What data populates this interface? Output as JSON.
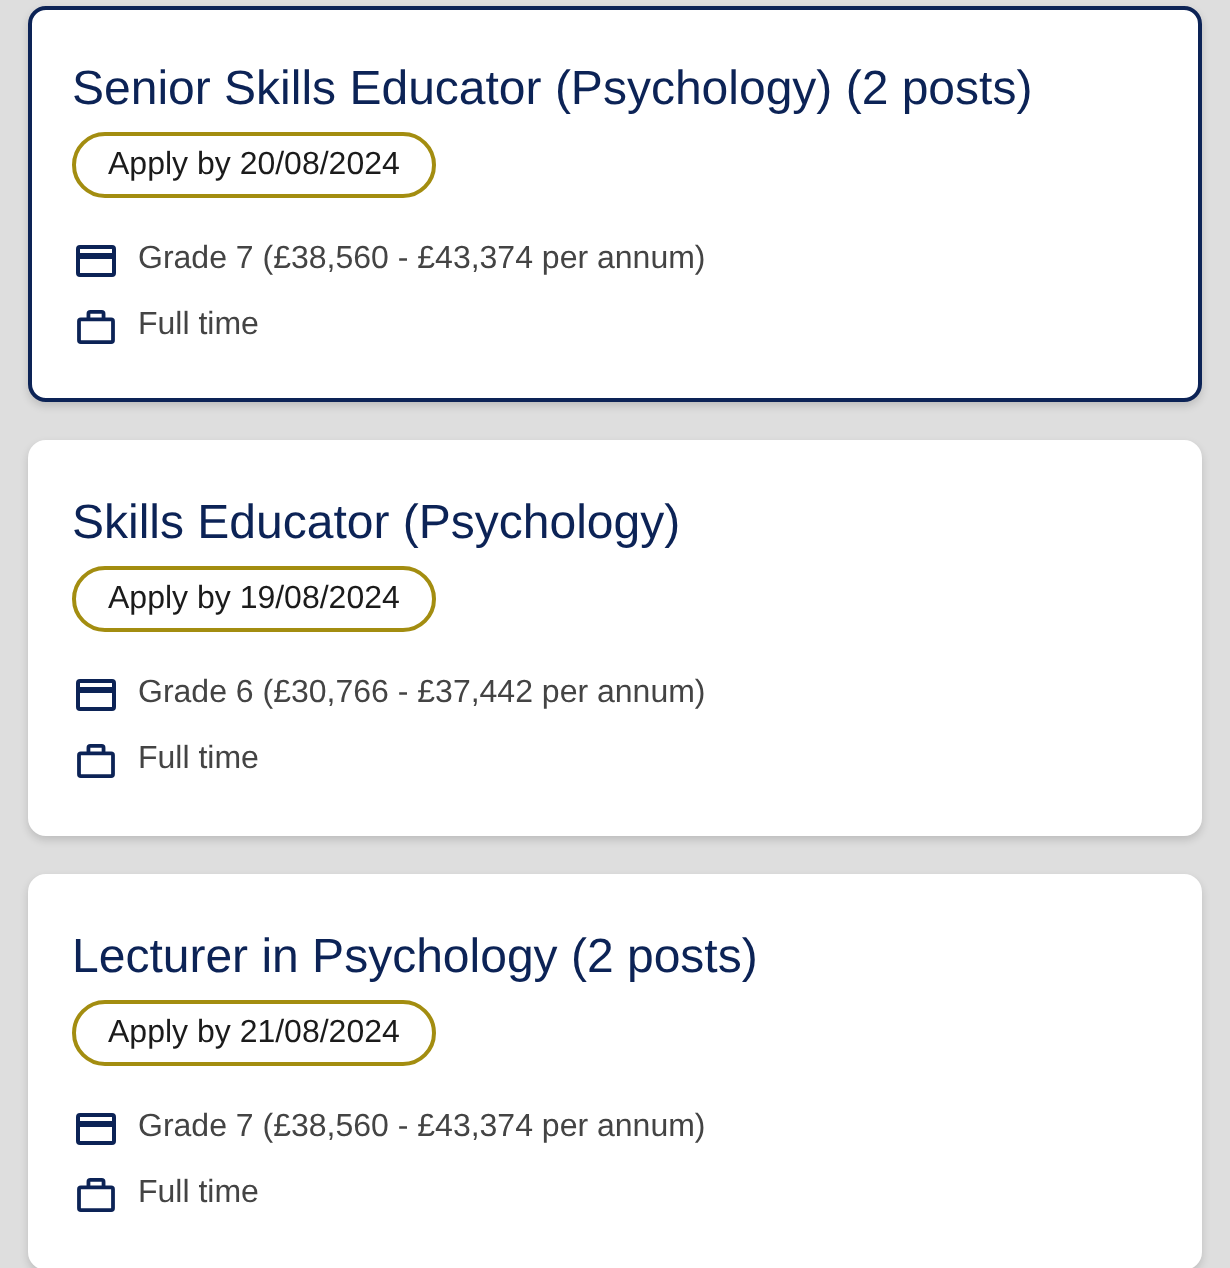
{
  "jobs": [
    {
      "title": "Senior Skills Educator (Psychology) (2 posts)",
      "selected": true,
      "deadline": "Apply by 20/08/2024",
      "details": [
        {
          "kind": "salary",
          "text": "Grade 7 (£38,560 - £43,374 per annum)"
        },
        {
          "kind": "hours",
          "text": "Full time"
        }
      ]
    },
    {
      "title": "Skills Educator (Psychology)",
      "selected": false,
      "deadline": "Apply by 19/08/2024",
      "details": [
        {
          "kind": "salary",
          "text": "Grade 6 (£30,766 - £37,442 per annum)"
        },
        {
          "kind": "hours",
          "text": "Full time"
        }
      ]
    },
    {
      "title": "Lecturer in Psychology (2 posts)",
      "selected": false,
      "deadline": "Apply by 21/08/2024",
      "details": [
        {
          "kind": "salary",
          "text": "Grade 7 (£38,560 - £43,374 per annum)"
        },
        {
          "kind": "hours",
          "text": "Full time"
        }
      ]
    }
  ]
}
